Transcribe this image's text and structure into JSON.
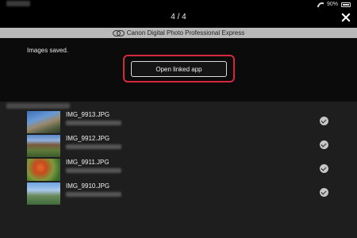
{
  "status_bar": {
    "battery": "90%"
  },
  "top_bar": {
    "page_counter": "4 / 4"
  },
  "banner": {
    "app_name": "Canon Digital Photo Professional Express"
  },
  "result": {
    "message": "Images saved.",
    "open_button_label": "Open linked app"
  },
  "files": [
    {
      "name": "IMG_9913.JPG",
      "selected": true
    },
    {
      "name": "IMG_9912.JPG",
      "selected": true
    },
    {
      "name": "IMG_9911.JPG",
      "selected": true
    },
    {
      "name": "IMG_9910.JPG",
      "selected": true
    }
  ],
  "icons": {
    "close": "close-icon",
    "check": "check-icon",
    "wifi": "wifi-icon",
    "battery": "battery-icon",
    "logo": "canon-logo-icon"
  },
  "colors": {
    "highlight": "#d4283f",
    "banner": "#b9b9b9"
  }
}
